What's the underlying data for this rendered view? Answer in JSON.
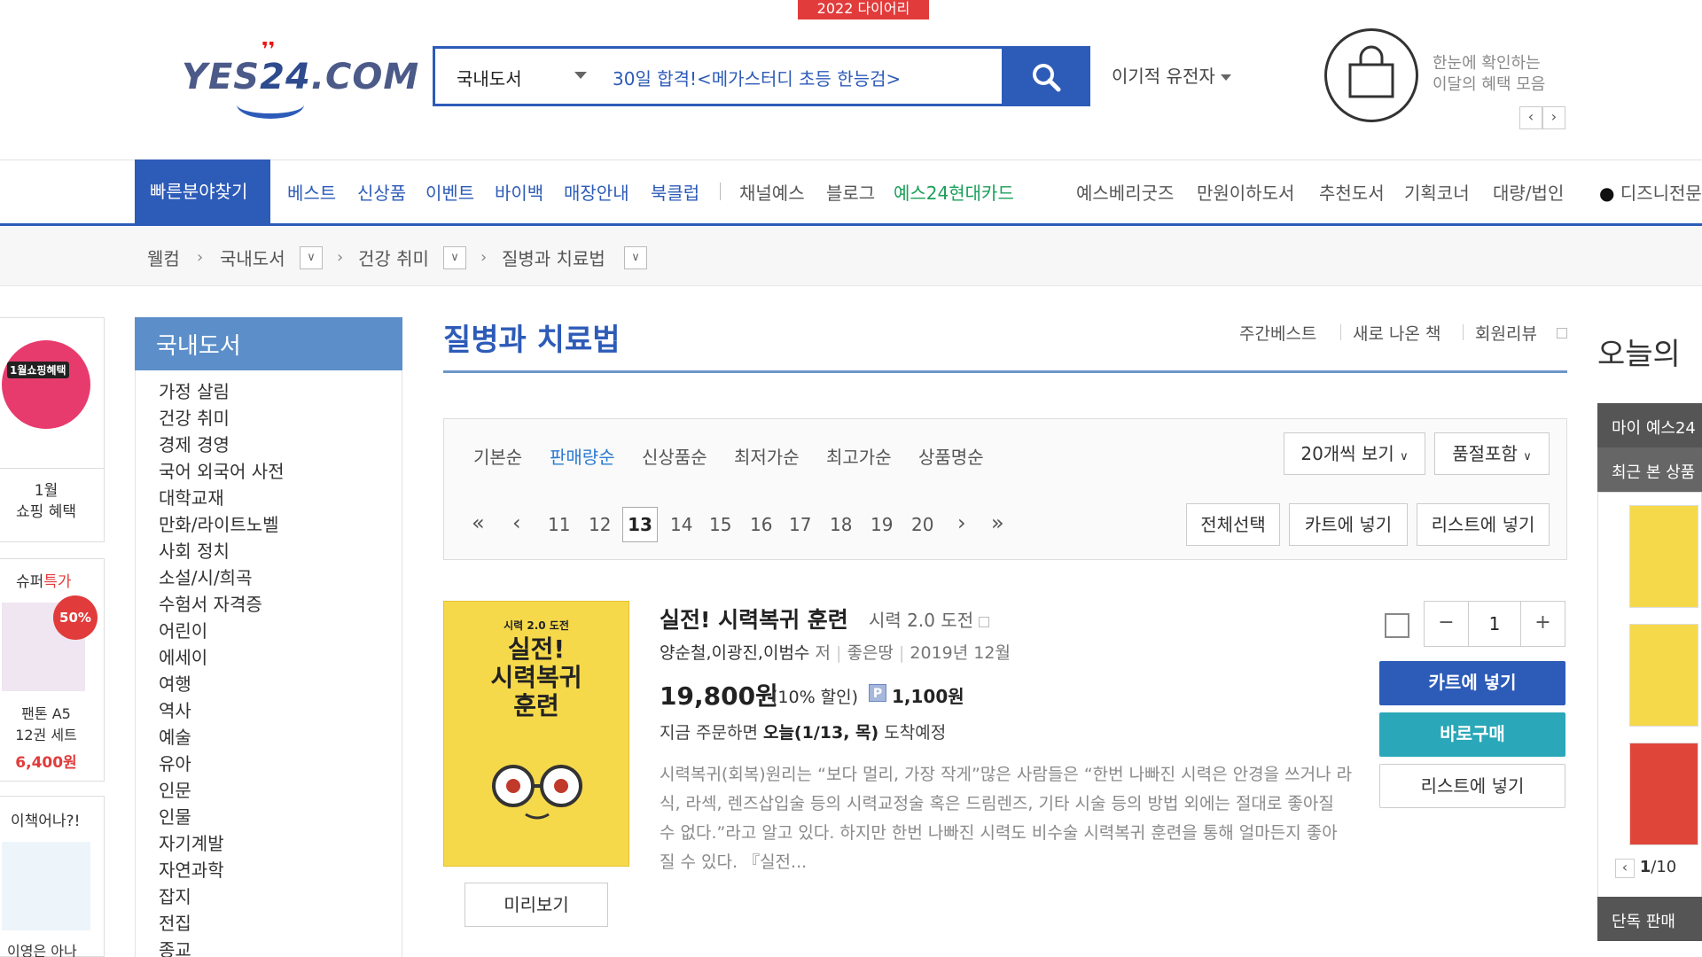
{
  "header": {
    "top_badge": "2022 다이어리",
    "logo": {
      "part1": "YES",
      "part2": "24",
      "part3": ".COM"
    },
    "search": {
      "category": "국내도서",
      "query": "30일 합격!<메가스터디 초등 한능검>"
    },
    "user": "이기적 유전자",
    "benefit_text": [
      "한눈에 확인하는",
      "이달의 혜택 모음"
    ],
    "prev": "‹",
    "next": "›"
  },
  "nav": {
    "find": "빠른분야찾기",
    "items": [
      "베스트",
      "신상품",
      "이벤트",
      "바이백",
      "매장안내",
      "북클럽"
    ],
    "items2": [
      "채널예스",
      "블로그"
    ],
    "card": "예스24현대카드",
    "right_items": [
      "예스베리굿즈",
      "만원이하도서",
      "추천도서",
      "기획코너",
      "대량/법인"
    ],
    "disney": "디즈니전문"
  },
  "breadcrumb": [
    "웰컴",
    "국내도서",
    "건강 취미",
    "질병과 치료법"
  ],
  "left_banners": {
    "badge": "1월쇼핑혜택",
    "b1": [
      "1월",
      "쇼핑 혜택"
    ],
    "super_a": "슈퍼",
    "super_b": "특가",
    "super_pct": "50%",
    "super_item": [
      "팬톤 A5",
      "12권 세트"
    ],
    "super_price": "6,400원",
    "b3_title": "이책어나?!",
    "b3_bottom": "이영은 아나"
  },
  "sidebar": {
    "title": "국내도서",
    "items": [
      "가정 살림",
      "건강 취미",
      "경제 경영",
      "국어 외국어 사전",
      "대학교재",
      "만화/라이트노벨",
      "사회 정치",
      "소설/시/희곡",
      "수험서 자격증",
      "어린이",
      "에세이",
      "여행",
      "역사",
      "예술",
      "유아",
      "인문",
      "인물",
      "자기계발",
      "자연과학",
      "잡지",
      "전집",
      "종교"
    ]
  },
  "main": {
    "title": "질병과 치료법",
    "top_links": [
      "주간베스트",
      "새로 나온 책",
      "회원리뷰"
    ],
    "sort": [
      "기본순",
      "판매량순",
      "신상품순",
      "최저가순",
      "최고가순",
      "상품명순"
    ],
    "view_count": "20개씩 보기",
    "soldout": "품절포함",
    "pages": [
      "11",
      "12",
      "13",
      "14",
      "15",
      "16",
      "17",
      "18",
      "19",
      "20"
    ],
    "current_page": "13",
    "select_all": "전체선택",
    "add_cart": "카트에 넣기",
    "add_list": "리스트에 넣기"
  },
  "product": {
    "cover_line1": "시력 2.0 도전",
    "cover_line2": "실전!\n시력복귀\n훈련",
    "preview": "미리보기",
    "title": "실전! 시력복귀 훈련",
    "subtitle": "시력 2.0 도전",
    "authors": "양순철,이광진,이범수",
    "author_suffix": "저",
    "publisher": "좋은땅",
    "date": "2019년 12월",
    "price": "19,800원",
    "discount": "(10% 할인)",
    "point_badge": "P",
    "point": "1,100원",
    "delivery_pre": "지금 주문하면",
    "delivery_date": "오늘(1/13, 목)",
    "delivery_post": "도착예정",
    "description": "시력복귀(회복)원리는 “보다 멀리, 가장 작게”많은 사람들은 “한번 나빠진 시력은 안경을 쓰거나 라식, 라섹, 렌즈삽입술 등의 시력교정술 혹은 드림렌즈, 기타 시술 등의 방법 외에는 절대로 좋아질 수 없다.”라고 알고 있다. 하지만 한번 나빠진 시력도 비수술 시력복귀 훈련을 통해 얼마든지 좋아질 수 있다. 『실전...",
    "qty": "1",
    "minus": "−",
    "plus": "+",
    "cart_btn": "카트에 넣기",
    "buy_btn": "바로구매",
    "list_btn": "리스트에 넣기"
  },
  "right_col": {
    "today": "오늘의",
    "my": "마이 예스24",
    "recent": "최근 본 상품",
    "pager_cur": "1",
    "pager_total": "/10",
    "solo": "단독 판매"
  }
}
